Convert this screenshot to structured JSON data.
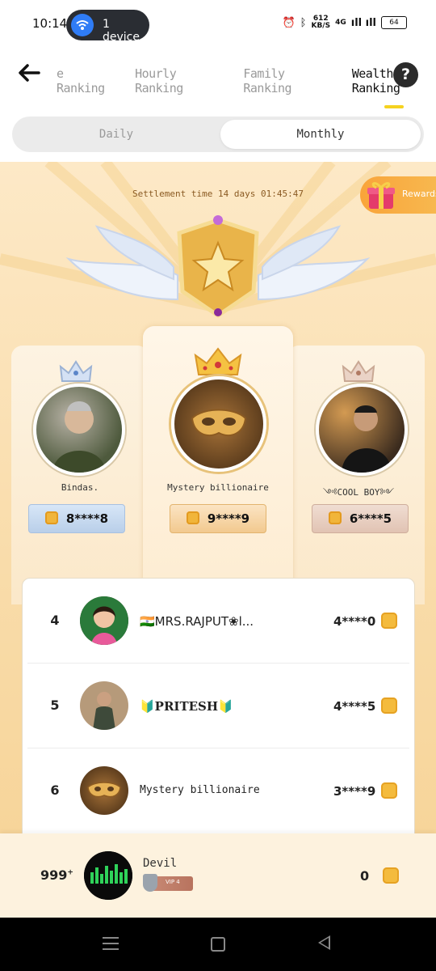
{
  "status_bar": {
    "time": "10:14",
    "device_pill": "1 device",
    "net_speed_value": "612",
    "net_speed_unit": "KB/S",
    "network": "4G",
    "battery": "64"
  },
  "header": {
    "tabs": [
      "e Ranking",
      "Hourly Ranking",
      "Family Ranking",
      "Wealth Ranking"
    ],
    "active_tab": "Wealth Ranking",
    "help_icon": "?"
  },
  "period": {
    "options": [
      "Daily",
      "Monthly"
    ],
    "selected": "Monthly"
  },
  "banner": {
    "settlement": "Settlement time 14 days 01:45:47",
    "rewards_label": "Rewards"
  },
  "podium": [
    {
      "place": 2,
      "name": "Bindas.",
      "score": "8****8",
      "color": "#c7d9ee"
    },
    {
      "place": 1,
      "name": "Mystery billionaire",
      "score": "9****9",
      "color": "#f6d7aa"
    },
    {
      "place": 3,
      "name": "༺COOL BOY༻",
      "score": "6****5",
      "color": "#e8cdbf"
    }
  ],
  "list": [
    {
      "rank": "4",
      "name": "🇮🇳MRS.RAJPUT❀l...",
      "score": "4****0"
    },
    {
      "rank": "5",
      "name": "🔰PRITESH🔰",
      "score": "4****5"
    },
    {
      "rank": "6",
      "name": "Mystery billionaire",
      "score": "3****9"
    }
  ],
  "me": {
    "rank": "999",
    "rank_suffix": "+",
    "name": "Devil",
    "vip": "VIP 4",
    "score": "0"
  },
  "colors": {
    "accent": "#f5d21f",
    "gold": "#f4bb3d",
    "banner_bg": "#f9dcaa"
  }
}
